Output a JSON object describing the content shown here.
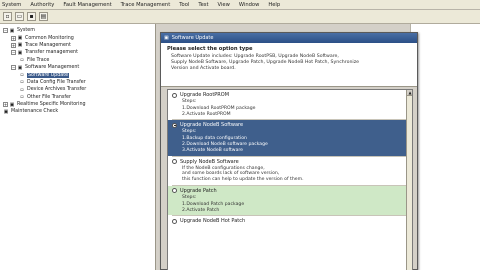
{
  "menubar": {
    "items": [
      "System",
      "Authority",
      "Fault Management",
      "Trace Management",
      "Tool",
      "Test",
      "View",
      "Window",
      "Help"
    ]
  },
  "toolbar": {
    "buttons": [
      "new",
      "open",
      "save",
      "print"
    ]
  },
  "tree": {
    "items": [
      {
        "label": "System",
        "indent": 0,
        "expanded": true
      },
      {
        "label": "Common Monitoring",
        "indent": 1,
        "expanded": false
      },
      {
        "label": "Trace Management",
        "indent": 1,
        "expanded": false
      },
      {
        "label": "Transfer management",
        "indent": 1,
        "expanded": true
      },
      {
        "label": "File Trace",
        "indent": 2
      },
      {
        "label": "Software Management",
        "indent": 1,
        "expanded": true
      },
      {
        "label": "Software Update",
        "indent": 2,
        "selected": true
      },
      {
        "label": "Data Config File Transfer",
        "indent": 2
      },
      {
        "label": "Device Archives Transfer",
        "indent": 2
      },
      {
        "label": "Other File Transfer",
        "indent": 2
      },
      {
        "label": "Realtime Specific Monitoring",
        "indent": 0,
        "expanded": false
      },
      {
        "label": "Maintenance Check",
        "indent": 0
      }
    ]
  },
  "dialog": {
    "title": "Software Update",
    "heading": "Please select the option type",
    "description_lines": [
      "Software Update includes: Upgrade RootPSB, Upgrade NodeB Software,",
      "Supply NodeB Software, Upgrade Patch, Upgrade NodeB Hot Patch, Synchronize",
      "Version and Activate board."
    ],
    "options": [
      {
        "label": "Upgrade RootPROM",
        "state": "normal",
        "checked": false,
        "steps_title": "Steps:",
        "steps": [
          "1.Download RootPROM package",
          "2.Activate RootPROM"
        ]
      },
      {
        "label": "Upgrade NodeB Software",
        "state": "selected",
        "checked": true,
        "steps_title": "Steps:",
        "steps": [
          "1.Backup data configuration",
          "2.Download NodeB software package",
          "3.Activate NodeB software"
        ]
      },
      {
        "label": "Supply NodeB Software",
        "state": "normal",
        "checked": false,
        "steps_title": "",
        "steps": [
          "If the NodeB configurations change,",
          "and some boards lack of software version,",
          "this function can help to update the version of them."
        ]
      },
      {
        "label": "Upgrade Patch",
        "state": "green",
        "checked": false,
        "steps_title": "Steps:",
        "steps": [
          "1.Download Patch package",
          "2.Activate Patch"
        ]
      },
      {
        "label": "Upgrade NodeB Hot Patch",
        "state": "normal",
        "checked": false,
        "steps_title": "",
        "steps": []
      }
    ]
  },
  "colors": {
    "selected_row": "#3f5f8c",
    "green_row": "#cfe8c6",
    "title_bar": "#2b4f86"
  }
}
